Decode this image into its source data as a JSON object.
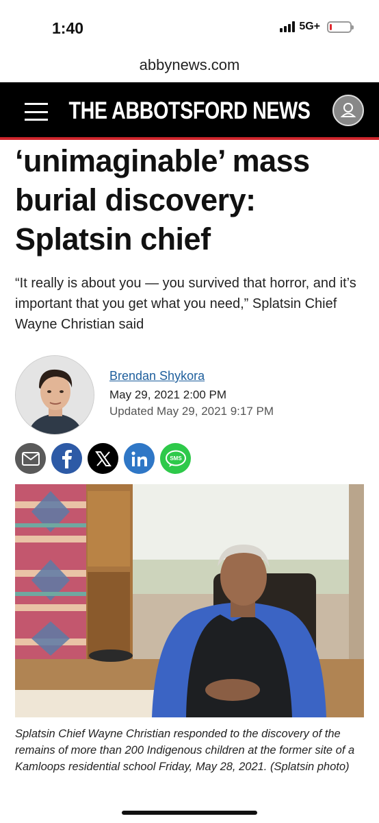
{
  "status_bar": {
    "time": "1:40",
    "network": "5G+",
    "battery_level": 0.12
  },
  "browser": {
    "url": "abbynews.com"
  },
  "header": {
    "site_title": "THE ABBOTSFORD NEWS",
    "brand_color": "#000000",
    "accent_color": "#d0262d",
    "menu_icon": "hamburger-menu-icon",
    "account_icon": "user-account-icon"
  },
  "article": {
    "headline": "‘unimaginable’ mass\nburial discovery:\nSplatsin chief",
    "subhead": "“It really is about you — you survived that horror, and it’s important that you get what you need,” Splatsin Chief Wayne Christian said",
    "author": {
      "name": "Brendan Shykora",
      "published": "May 29, 2021 2:00 PM",
      "updated": "Updated May 29, 2021 9:17 PM"
    },
    "share": [
      {
        "icon": "email-icon",
        "color": "#5a5a5a"
      },
      {
        "icon": "facebook-icon",
        "color": "#2d5aa6"
      },
      {
        "icon": "x-icon",
        "color": "#000000"
      },
      {
        "icon": "linkedin-icon",
        "color": "#2f77c6"
      },
      {
        "icon": "sms-icon",
        "color": "#2ec94a",
        "label": "SMS"
      }
    ],
    "photo_caption": "Splatsin Chief Wayne Christian responded to the discovery of the remains of more than 200 Indigenous children at the former site of a Kamloops residential school Friday, May 28, 2021. (Splatsin photo)"
  }
}
